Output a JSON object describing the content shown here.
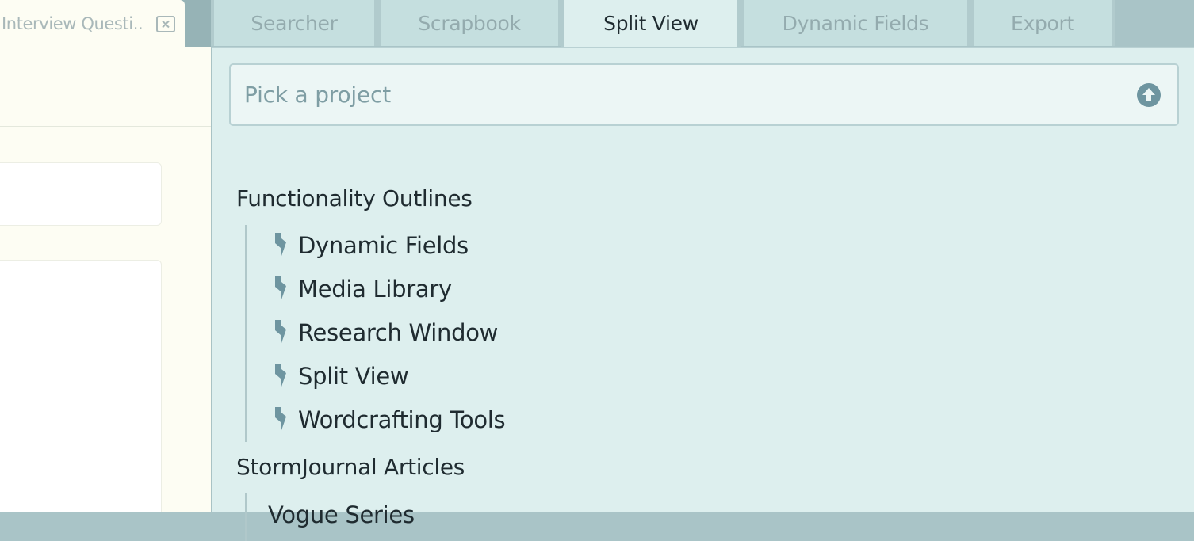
{
  "left_pane": {
    "doc_tab": {
      "label": "Interview Questi.."
    }
  },
  "tabs": [
    {
      "label": "Searcher",
      "active": false
    },
    {
      "label": "Scrapbook",
      "active": false
    },
    {
      "label": "Split View",
      "active": true
    },
    {
      "label": "Dynamic Fields",
      "active": false
    },
    {
      "label": "Export",
      "active": false
    }
  ],
  "project_picker": {
    "placeholder": "Pick a project",
    "icon": "circle-arrow-up-icon"
  },
  "tree": {
    "groups": [
      {
        "title": "Functionality Outlines",
        "items": [
          {
            "label": "Dynamic Fields",
            "icon": "lightning-icon"
          },
          {
            "label": "Media Library",
            "icon": "lightning-icon"
          },
          {
            "label": "Research Window",
            "icon": "lightning-icon"
          },
          {
            "label": "Split View",
            "icon": "lightning-icon"
          },
          {
            "label": "Wordcrafting Tools",
            "icon": "lightning-icon"
          }
        ]
      },
      {
        "title": "StormJournal Articles",
        "items": [
          {
            "label": "Vogue Series",
            "icon": "lightning-icon"
          }
        ]
      }
    ]
  },
  "colors": {
    "accent_icon": "#6e95a0",
    "panel_bg": "#ddefee",
    "inactive_tab_bg": "#c5dfdf",
    "text_dark": "#1f2b30",
    "left_pane_bg": "#fdfdf3"
  }
}
